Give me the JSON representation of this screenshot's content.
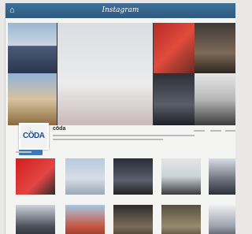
{
  "app": {
    "title": "Instagram",
    "home_icon": "home-icon"
  },
  "profile": {
    "avatar_logo_text": "CÖDA",
    "username": "cöda",
    "follow_button": ""
  }
}
